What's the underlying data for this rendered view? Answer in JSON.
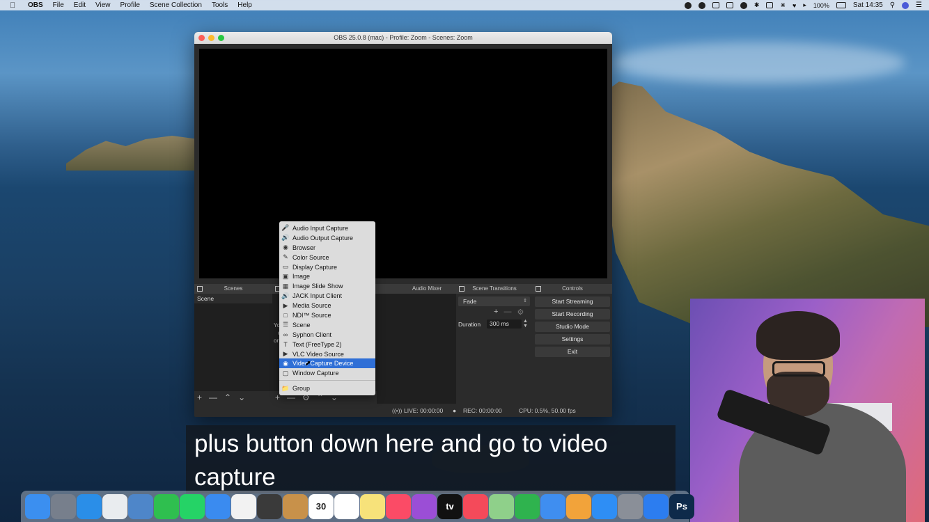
{
  "menubar": {
    "app_name": "OBS",
    "items": [
      "File",
      "Edit",
      "View",
      "Profile",
      "Scene Collection",
      "Tools",
      "Help"
    ],
    "battery": "100%",
    "clock": "Sat 14:35"
  },
  "window": {
    "title": "OBS 25.0.8 (mac) - Profile: Zoom - Scenes: Zoom"
  },
  "docks": {
    "scenes": "Scenes",
    "audio_mixer": "Audio Mixer",
    "scene_transitions": "Scene Transitions",
    "controls": "Controls"
  },
  "scenes": {
    "items": [
      "Scene"
    ]
  },
  "sources_partial": {
    "line1": "Yo",
    "line2": "o",
    "line3": "or"
  },
  "transitions": {
    "selected": "Fade",
    "duration_label": "Duration",
    "duration_value": "300 ms"
  },
  "controls": {
    "start_streaming": "Start Streaming",
    "start_recording": "Start Recording",
    "studio_mode": "Studio Mode",
    "settings": "Settings",
    "exit": "Exit"
  },
  "status": {
    "live": "LIVE: 00:00:00",
    "rec": "REC: 00:00:00",
    "cpu": "CPU: 0.5%, 50.00 fps"
  },
  "context_menu": {
    "items": [
      {
        "label": "Audio Input Capture",
        "icon": "microphone-icon"
      },
      {
        "label": "Audio Output Capture",
        "icon": "speaker-icon"
      },
      {
        "label": "Browser",
        "icon": "globe-icon"
      },
      {
        "label": "Color Source",
        "icon": "brush-icon"
      },
      {
        "label": "Display Capture",
        "icon": "monitor-icon"
      },
      {
        "label": "Image",
        "icon": "image-icon"
      },
      {
        "label": "Image Slide Show",
        "icon": "slideshow-icon"
      },
      {
        "label": "JACK Input Client",
        "icon": "speaker-icon"
      },
      {
        "label": "Media Source",
        "icon": "play-icon"
      },
      {
        "label": "NDI™ Source",
        "icon": "file-icon"
      },
      {
        "label": "Scene",
        "icon": "list-icon"
      },
      {
        "label": "Syphon Client",
        "icon": "link-icon"
      },
      {
        "label": "Text (FreeType 2)",
        "icon": "text-icon"
      },
      {
        "label": "VLC Video Source",
        "icon": "play-icon"
      },
      {
        "label": "Video Capture Device",
        "icon": "camera-icon"
      },
      {
        "label": "Window Capture",
        "icon": "window-icon"
      }
    ],
    "group": "Group",
    "selected_index": 14
  },
  "subtitle": {
    "line1": "plus button down here and go to video",
    "line2": "capture"
  },
  "dock_apps": [
    {
      "name": "finder-icon",
      "color": "#3b8ff0"
    },
    {
      "name": "launchpad-icon",
      "color": "#777f8c"
    },
    {
      "name": "safari-icon",
      "color": "#2a8ee8"
    },
    {
      "name": "chrome-icon",
      "color": "#e9ecef"
    },
    {
      "name": "preview-icon",
      "color": "#4e86c9"
    },
    {
      "name": "facetime-icon",
      "color": "#2fbf4f"
    },
    {
      "name": "whatsapp-icon",
      "color": "#25d366"
    },
    {
      "name": "messages-icon",
      "color": "#3a8bf0"
    },
    {
      "name": "photos-icon",
      "color": "#f2f2f2"
    },
    {
      "name": "final-cut-icon",
      "color": "#3a3a3a"
    },
    {
      "name": "notebook-icon",
      "color": "#c8914a"
    },
    {
      "name": "calendar-icon",
      "color": "#ffffff",
      "text": "30"
    },
    {
      "name": "reminders-icon",
      "color": "#ffffff"
    },
    {
      "name": "notes-icon",
      "color": "#f7e27a"
    },
    {
      "name": "music-icon",
      "color": "#fb4b66"
    },
    {
      "name": "podcasts-icon",
      "color": "#9b4ed6"
    },
    {
      "name": "apple-tv-icon",
      "color": "#111111",
      "text": "tv"
    },
    {
      "name": "news-icon",
      "color": "#f44a5a"
    },
    {
      "name": "maps-icon",
      "color": "#8fd08a"
    },
    {
      "name": "numbers-icon",
      "color": "#2fb34e"
    },
    {
      "name": "keynote-icon",
      "color": "#3f8ef0"
    },
    {
      "name": "pages-icon",
      "color": "#f2a33a"
    },
    {
      "name": "app-store-icon",
      "color": "#2e8ef5"
    },
    {
      "name": "system-preferences-icon",
      "color": "#8a8f98"
    },
    {
      "name": "location-icon",
      "color": "#2c7df0"
    },
    {
      "name": "photoshop-icon",
      "color": "#0e2a4a",
      "text": "Ps"
    }
  ]
}
